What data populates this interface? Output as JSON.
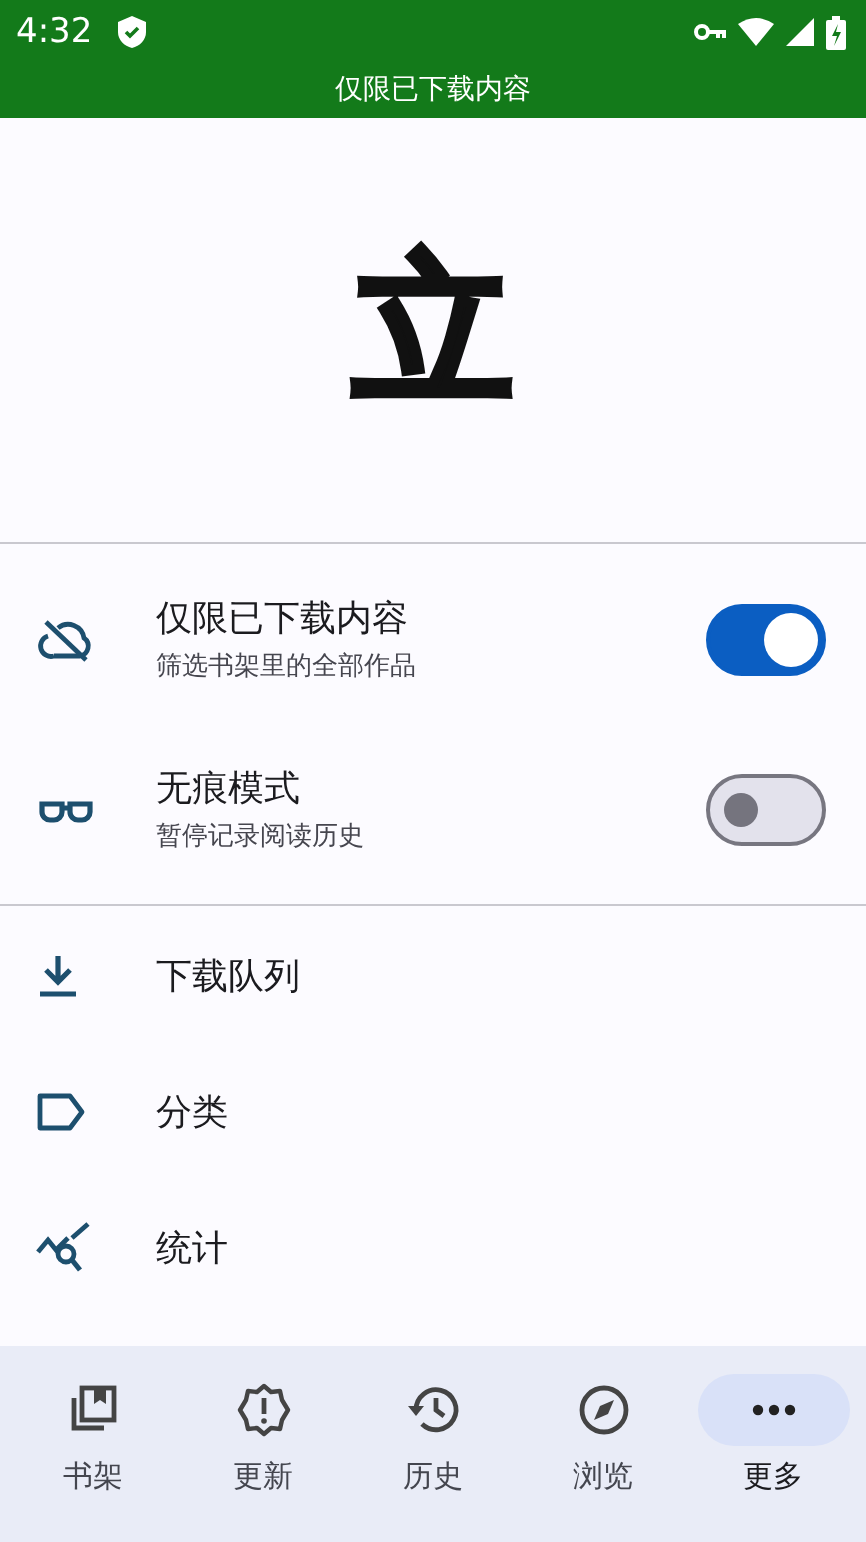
{
  "status_bar": {
    "time": "4:32"
  },
  "banner": {
    "title": "仅限已下载内容"
  },
  "logo": {
    "text": "立"
  },
  "toggles": [
    {
      "kind": "cloud-off",
      "title": "仅限已下载内容",
      "subtitle": "筛选书架里的全部作品",
      "on": true
    },
    {
      "kind": "glasses",
      "title": "无痕模式",
      "subtitle": "暂停记录阅读历史",
      "on": false
    }
  ],
  "menu": [
    {
      "kind": "download",
      "label": "下载队列"
    },
    {
      "kind": "label",
      "label": "分类"
    },
    {
      "kind": "stats",
      "label": "统计"
    }
  ],
  "bottom_nav": [
    {
      "kind": "library",
      "label": "书架",
      "selected": false
    },
    {
      "kind": "updates",
      "label": "更新",
      "selected": false
    },
    {
      "kind": "history",
      "label": "历史",
      "selected": false
    },
    {
      "kind": "browse",
      "label": "浏览",
      "selected": false
    },
    {
      "kind": "more",
      "label": "更多",
      "selected": true
    }
  ]
}
